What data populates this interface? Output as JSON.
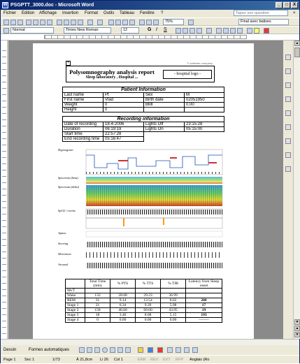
{
  "window": {
    "title": "PSGPTT_3000.doc - Microsoft Word",
    "app_icon": "W",
    "controls": {
      "minimize": "_",
      "maximize": "□",
      "close": "X"
    }
  },
  "menu": {
    "items": [
      "Fichier",
      "Edition",
      "Affichage",
      "Insertion",
      "Format",
      "Outils",
      "Tableau",
      "Fenêtre",
      "?"
    ],
    "ask_placeholder": "Tapez une question",
    "close_doc": "×"
  },
  "toolbar": {
    "zoom": "75%",
    "view_mode": "Final avec balises",
    "style": "Normal",
    "font": "Times New Roman",
    "size": "12",
    "bold": "G",
    "italic": "I",
    "underline": "S"
  },
  "report": {
    "title": "Polysomnography analysis report",
    "subtitle": "Sleep laboratory , Hospital ...",
    "logo": "- hospital logo -",
    "corner_tag": "© software company",
    "patient_header": "Patient Information",
    "patient": [
      [
        "Last name",
        "Pt",
        "Sex",
        "M"
      ],
      [
        "First name",
        "Vlad",
        "Birth date",
        "02051950"
      ],
      [
        "Weight",
        "0",
        "BMI",
        "0.00"
      ],
      [
        "Height",
        "0",
        "",
        ""
      ]
    ],
    "recording_header": "Recording information",
    "recording": [
      [
        "Date of recording",
        "18-4-2006",
        "Lights Off",
        "23:15:28"
      ],
      [
        "Duration",
        "06:19:19",
        "Lights On",
        "05:15:00"
      ],
      [
        "Start time",
        "22:57:28",
        "",
        ""
      ],
      [
        "End recording time",
        "05:16:47",
        "",
        ""
      ]
    ],
    "plot_labels": [
      "Hypnogram",
      "Spectrum (beta)",
      "Spectrum (delta)",
      "SpO2 / events",
      "Apnea",
      "Snoring",
      "Movement",
      "Arousal"
    ],
    "stats_header": [
      "",
      "Total Time (min)",
      "% PTS",
      "% TTS",
      "% TIB",
      "Latency from Sleep onset"
    ],
    "stats_rows": [
      [
        "MvT",
        "",
        "",
        "",
        "",
        ""
      ],
      [
        "Wake",
        "133",
        "28.08",
        "29.23",
        "36.99",
        ""
      ],
      [
        "REM",
        "31",
        "9.14",
        "13.54",
        "8.62",
        "200"
      ],
      [
        "Stage 1",
        "21",
        "6.34",
        "9.39",
        "5.98",
        "17"
      ],
      [
        "Stage 2",
        "158",
        "46.60",
        "69.00",
        "43.95",
        "19"
      ],
      [
        "Stage 3",
        "18",
        "3.46",
        "8.08",
        "5.15",
        "193"
      ],
      [
        "Stage 4",
        "0",
        "0.00",
        "0.00",
        "0.00",
        "--------"
      ]
    ]
  },
  "drawbar": {
    "dessin": "Dessin",
    "formes": "Formes automatiques"
  },
  "status": {
    "page": "Page 1",
    "section": "Sec 1",
    "pages": "1/73",
    "position": "À 21,8cm",
    "line": "Li 26",
    "col": "Col 1",
    "rec": "ENR",
    "rev": "REV",
    "ext": "EXT",
    "ovr": "RFP",
    "lang": "Anglais (Ro"
  }
}
